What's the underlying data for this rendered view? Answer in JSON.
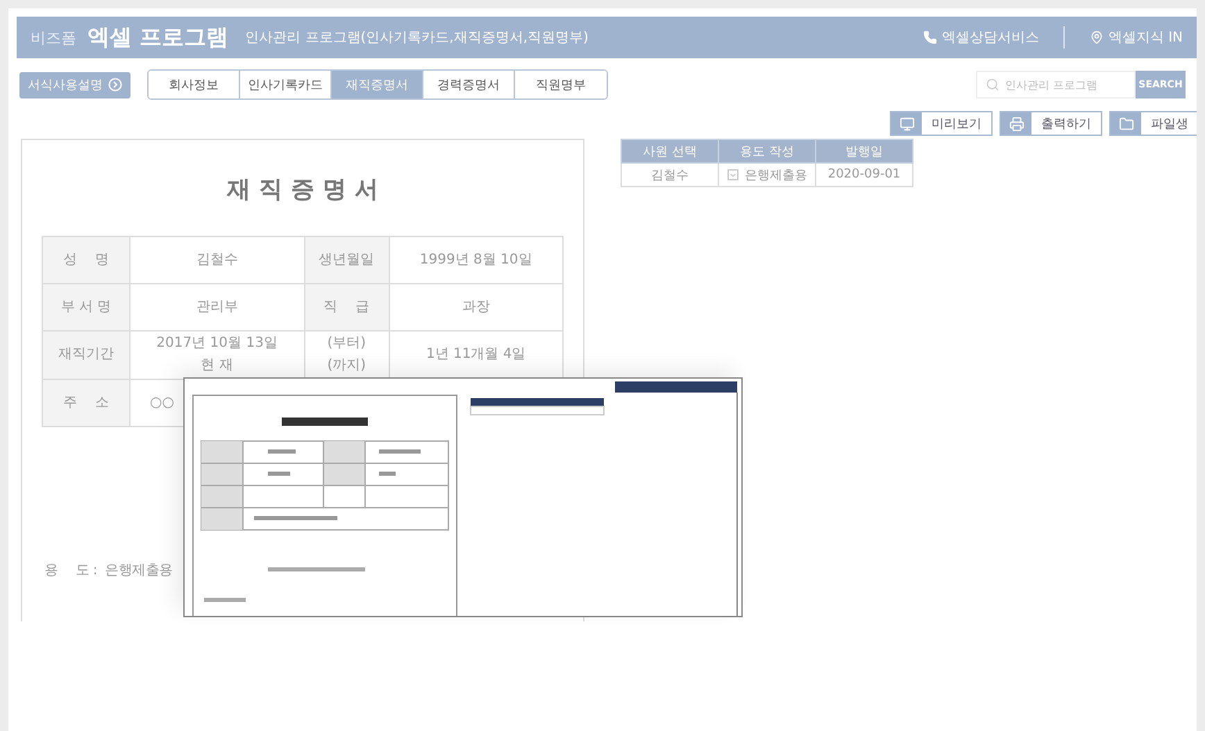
{
  "header": {
    "brand_small": "비즈폼",
    "brand": "엑셀 프로그램",
    "subtitle": "인사관리 프로그램(인사기록카드,재직증명서,직원명부)",
    "links": [
      "엑셀상담서비스",
      "엑셀지식 IN"
    ]
  },
  "guide_button": "서식사용설명",
  "tabs": [
    {
      "label": "회사정보",
      "selected": false
    },
    {
      "label": "인사기록카드",
      "selected": false
    },
    {
      "label": "재직증명서",
      "selected": true
    },
    {
      "label": "경력증명서",
      "selected": false
    },
    {
      "label": "직원명부",
      "selected": false
    }
  ],
  "search": {
    "placeholder": "인사관리 프로그램",
    "button": "SEARCH"
  },
  "actions": [
    {
      "kind": "preview",
      "label": "미리보기"
    },
    {
      "kind": "print",
      "label": "출력하기"
    },
    {
      "kind": "file",
      "label": "파일생"
    }
  ],
  "document": {
    "title": "재 직 증 명 서",
    "rows": [
      [
        {
          "kind": "label",
          "lines": [
            "성　 명"
          ]
        },
        {
          "kind": "value",
          "lines": [
            "김철수"
          ]
        },
        {
          "kind": "label",
          "lines": [
            "생년월일"
          ]
        },
        {
          "kind": "value",
          "lines": [
            "1999년 8월 10일"
          ]
        }
      ],
      [
        {
          "kind": "label",
          "lines": [
            "부 서 명"
          ]
        },
        {
          "kind": "value",
          "lines": [
            "관리부"
          ]
        },
        {
          "kind": "label",
          "lines": [
            "직　 급"
          ]
        },
        {
          "kind": "value",
          "lines": [
            "과장"
          ]
        }
      ],
      [
        {
          "kind": "label",
          "lines": [
            "재직기간"
          ]
        },
        {
          "kind": "value",
          "lines": [
            "2017년 10월 13일",
            "현 재"
          ]
        },
        {
          "kind": "value",
          "lines": [
            "(부터)",
            "(까지)"
          ]
        },
        {
          "kind": "value",
          "lines": [
            "1년 11개월 4일"
          ]
        }
      ],
      [
        {
          "kind": "label",
          "lines": [
            "주　 소"
          ]
        },
        {
          "kind": "wide",
          "lines": [
            "○○"
          ]
        }
      ]
    ],
    "purpose": "용　 도 :  은행제출용"
  },
  "issue_table": {
    "columns": [
      "사원 선택",
      "용도 작성",
      "발행일"
    ],
    "rows": [
      {
        "employee": "김철수",
        "purpose": "은행제출용",
        "date": "2020-09-01"
      }
    ]
  }
}
